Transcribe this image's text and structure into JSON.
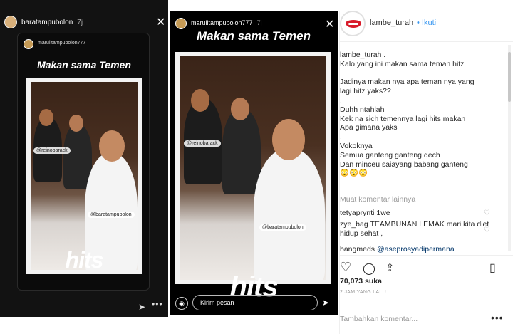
{
  "left_story": {
    "username": "baratampubolon",
    "age": "7j",
    "inner_username": "marulitampubolon777",
    "title": "Makan sama Temen",
    "photo_tags": [
      "@reinobarack",
      "@baratampubolon"
    ],
    "bottom_text": "hits"
  },
  "middle_story": {
    "username": "marulitampubolon777",
    "age": "7j",
    "title": "Makan sama Temen",
    "photo_tags": [
      "@reinobarack",
      "@baratampubolon"
    ],
    "bottom_text": "hits",
    "reply_placeholder": "Kirim pesan"
  },
  "post": {
    "username": "lambe_turah",
    "follow_label": "• Ikuti",
    "caption_lines": [
      "lambe_turah .",
      "Kalo yang ini makan sama teman hitz",
      ".",
      "Jadinya makan nya apa teman nya yang",
      "lagi hitz yaks??",
      ".",
      "Duhh ntahlah",
      "Kek na sich temennya lagi hits makan",
      "Apa gimana yaks",
      ".",
      "Vokoknya",
      "Semua ganteng ganteng dech",
      "Dan minceu saiayang babang ganteng",
      "😳😳😳"
    ],
    "more_comments": "Muat komentar lainnya",
    "comments": [
      {
        "user": "tetyaprynti",
        "text": "1we"
      },
      {
        "user": "zye_bag",
        "text": "TEAMBUNAN LEMAK mari kita diet hidup sehat ,"
      },
      {
        "user": "bangmeds",
        "text": "@aseprosyadipermana"
      }
    ],
    "likes": "70,073 suka",
    "time": "2 JAM YANG LALU",
    "comment_placeholder": "Tambahkan komentar..."
  },
  "icons": [
    "close-icon",
    "send-icon",
    "camera-icon",
    "heart-icon",
    "comment-icon",
    "share-icon",
    "bookmark-icon",
    "more-icon"
  ]
}
